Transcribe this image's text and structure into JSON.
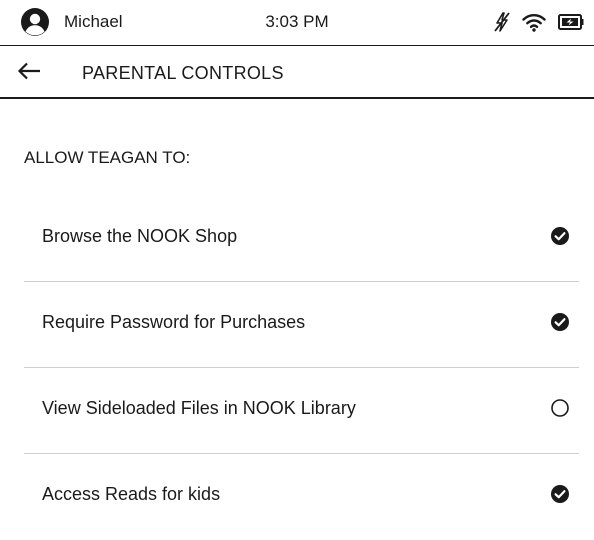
{
  "status_bar": {
    "user_name": "Michael",
    "time": "3:03 PM",
    "icons": [
      "avatar-icon",
      "charging-off-icon",
      "wifi-icon",
      "battery-icon"
    ]
  },
  "header": {
    "back_icon": "arrow-left-icon",
    "title": "PARENTAL CONTROLS"
  },
  "section": {
    "heading": "ALLOW TEAGAN TO:"
  },
  "settings": [
    {
      "label": "Browse the NOOK Shop",
      "checked": true
    },
    {
      "label": "Require Password for Purchases",
      "checked": true
    },
    {
      "label": "View Sideloaded Files in NOOK Library",
      "checked": false
    },
    {
      "label": "Access Reads for kids",
      "checked": true
    }
  ]
}
